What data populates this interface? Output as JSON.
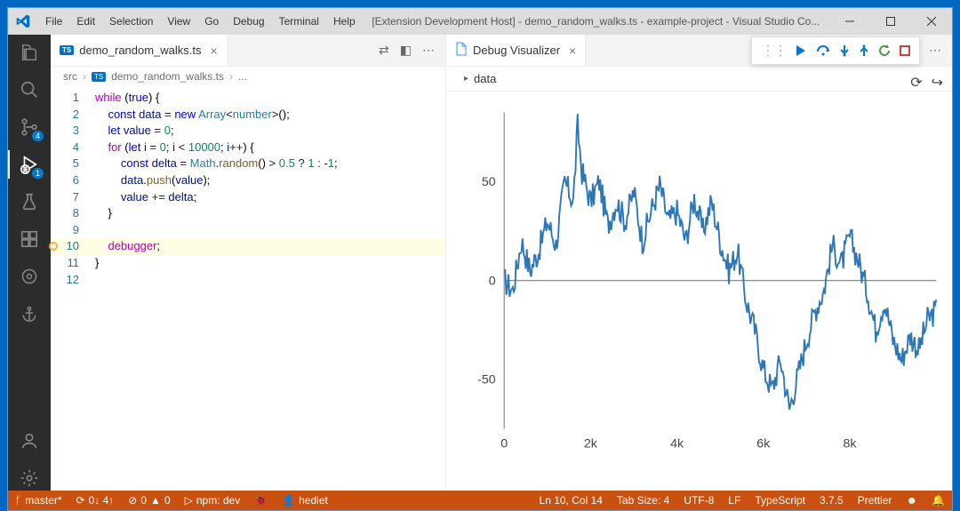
{
  "window": {
    "title": "[Extension Development Host] - demo_random_walks.ts - example-project - Visual Studio Co..."
  },
  "menu": {
    "items": [
      "File",
      "Edit",
      "Selection",
      "View",
      "Go",
      "Debug",
      "Terminal",
      "Help"
    ]
  },
  "activitybar": {
    "items": [
      {
        "name": "explorer",
        "badge": null
      },
      {
        "name": "search",
        "badge": null
      },
      {
        "name": "source-control",
        "badge": "4"
      },
      {
        "name": "debug",
        "badge": "1",
        "active": true
      },
      {
        "name": "testing",
        "badge": null
      },
      {
        "name": "extensions",
        "badge": null
      },
      {
        "name": "keep",
        "badge": null
      },
      {
        "name": "anchor",
        "badge": null
      }
    ],
    "bottom": [
      {
        "name": "accounts"
      },
      {
        "name": "settings"
      }
    ]
  },
  "leftPane": {
    "tab": {
      "label": "demo_random_walks.ts"
    },
    "breadcrumb": {
      "seg1": "src",
      "seg2": "demo_random_walks.ts",
      "tail": "..."
    },
    "code": [
      {
        "n": 1,
        "html": "<span class='k-purple'>while</span> <span class='k-brace'>(</span><span class='k-blue'>true</span><span class='k-brace'>)</span> <span class='k-brace'>{</span>"
      },
      {
        "n": 2,
        "html": "    <span class='k-blue'>const</span> <span class='k-prop'>data</span> <span class='k-op'>=</span> <span class='k-blue'>new</span> <span class='k-type'>Array</span><span class='k-op'>&lt;</span><span class='k-type'>number</span><span class='k-op'>&gt;</span>();"
      },
      {
        "n": 3,
        "html": "    <span class='k-blue'>let</span> <span class='k-prop'>value</span> <span class='k-op'>=</span> <span class='k-num'>0</span>;"
      },
      {
        "n": 4,
        "html": "    <span class='k-purple'>for</span> (<span class='k-blue'>let</span> <span class='k-prop'>i</span> <span class='k-op'>=</span> <span class='k-num'>0</span>; <span class='k-prop'>i</span> <span class='k-op'>&lt;</span> <span class='k-num'>10000</span>; <span class='k-prop'>i</span><span class='k-op'>++</span>) {"
      },
      {
        "n": 5,
        "html": "        <span class='k-blue'>const</span> <span class='k-prop'>delta</span> <span class='k-op'>=</span> <span class='k-type'>Math</span>.<span class='k-func'>random</span>() <span class='k-op'>&gt;</span> <span class='k-num'>0.5</span> <span class='k-op'>?</span> <span class='k-num'>1</span> <span class='k-op'>:</span> <span class='k-op'>-</span><span class='k-num'>1</span>;"
      },
      {
        "n": 6,
        "html": "        <span class='k-prop'>data</span>.<span class='k-func'>push</span>(<span class='k-prop'>value</span>);"
      },
      {
        "n": 7,
        "html": "        <span class='k-prop'>value</span> <span class='k-op'>+=</span> <span class='k-prop'>delta</span>;"
      },
      {
        "n": 8,
        "html": "    }"
      },
      {
        "n": 9,
        "html": ""
      },
      {
        "n": 10,
        "html": "    <span class='k-dbg'>debugger</span>;",
        "hl": true,
        "bp": true
      },
      {
        "n": 11,
        "html": "}"
      },
      {
        "n": 12,
        "html": ""
      }
    ]
  },
  "rightPane": {
    "tab": {
      "label": "Debug Visualizer"
    },
    "expression": "data"
  },
  "debugToolbar": {
    "buttons": [
      "continue",
      "step-over",
      "step-into",
      "step-out",
      "restart",
      "stop"
    ]
  },
  "statusbar": {
    "left": [
      {
        "name": "branch",
        "text": "master*"
      },
      {
        "name": "sync",
        "text": "0↓ 4↑"
      },
      {
        "name": "problems",
        "text": "0  0"
      },
      {
        "name": "npm",
        "text": "npm: dev"
      },
      {
        "name": "debug-target",
        "text": ""
      },
      {
        "name": "live",
        "text": "hediet"
      }
    ],
    "right": [
      {
        "name": "cursor",
        "text": "Ln 10, Col 14"
      },
      {
        "name": "tabsize",
        "text": "Tab Size: 4"
      },
      {
        "name": "encoding",
        "text": "UTF-8"
      },
      {
        "name": "eol",
        "text": "LF"
      },
      {
        "name": "lang",
        "text": "TypeScript"
      },
      {
        "name": "version",
        "text": "3.7.5"
      },
      {
        "name": "prettier",
        "text": "Prettier"
      },
      {
        "name": "feedback",
        "text": ""
      },
      {
        "name": "bell",
        "text": ""
      }
    ]
  },
  "chart_data": {
    "type": "line",
    "title": "",
    "xlabel": "",
    "ylabel": "",
    "xlim": [
      0,
      10000
    ],
    "ylim": [
      -75,
      85
    ],
    "x_ticks": [
      0,
      2000,
      4000,
      6000,
      8000
    ],
    "x_tick_labels": [
      "0",
      "2k",
      "4k",
      "6k",
      "8k"
    ],
    "y_ticks": [
      -50,
      0,
      50
    ],
    "series": [
      {
        "name": "data",
        "color": "#2f77b4",
        "x": [
          0,
          200,
          400,
          600,
          800,
          1000,
          1200,
          1400,
          1600,
          1700,
          1800,
          2000,
          2200,
          2400,
          2600,
          2800,
          3000,
          3200,
          3400,
          3600,
          3800,
          4000,
          4200,
          4400,
          4600,
          4800,
          5000,
          5200,
          5400,
          5600,
          5800,
          6000,
          6200,
          6400,
          6600,
          6800,
          7000,
          7200,
          7400,
          7600,
          7800,
          8000,
          8200,
          8400,
          8600,
          8800,
          9000,
          9200,
          9400,
          9600,
          9800,
          10000
        ],
        "y": [
          0,
          -5,
          20,
          5,
          15,
          30,
          18,
          50,
          40,
          78,
          55,
          40,
          50,
          28,
          40,
          30,
          45,
          20,
          35,
          48,
          30,
          35,
          20,
          42,
          25,
          40,
          20,
          5,
          15,
          -10,
          -25,
          -45,
          -55,
          -40,
          -65,
          -48,
          -30,
          -15,
          -5,
          18,
          8,
          22,
          10,
          -5,
          -25,
          -10,
          -30,
          -40,
          -28,
          -35,
          -20,
          -15
        ]
      }
    ]
  }
}
